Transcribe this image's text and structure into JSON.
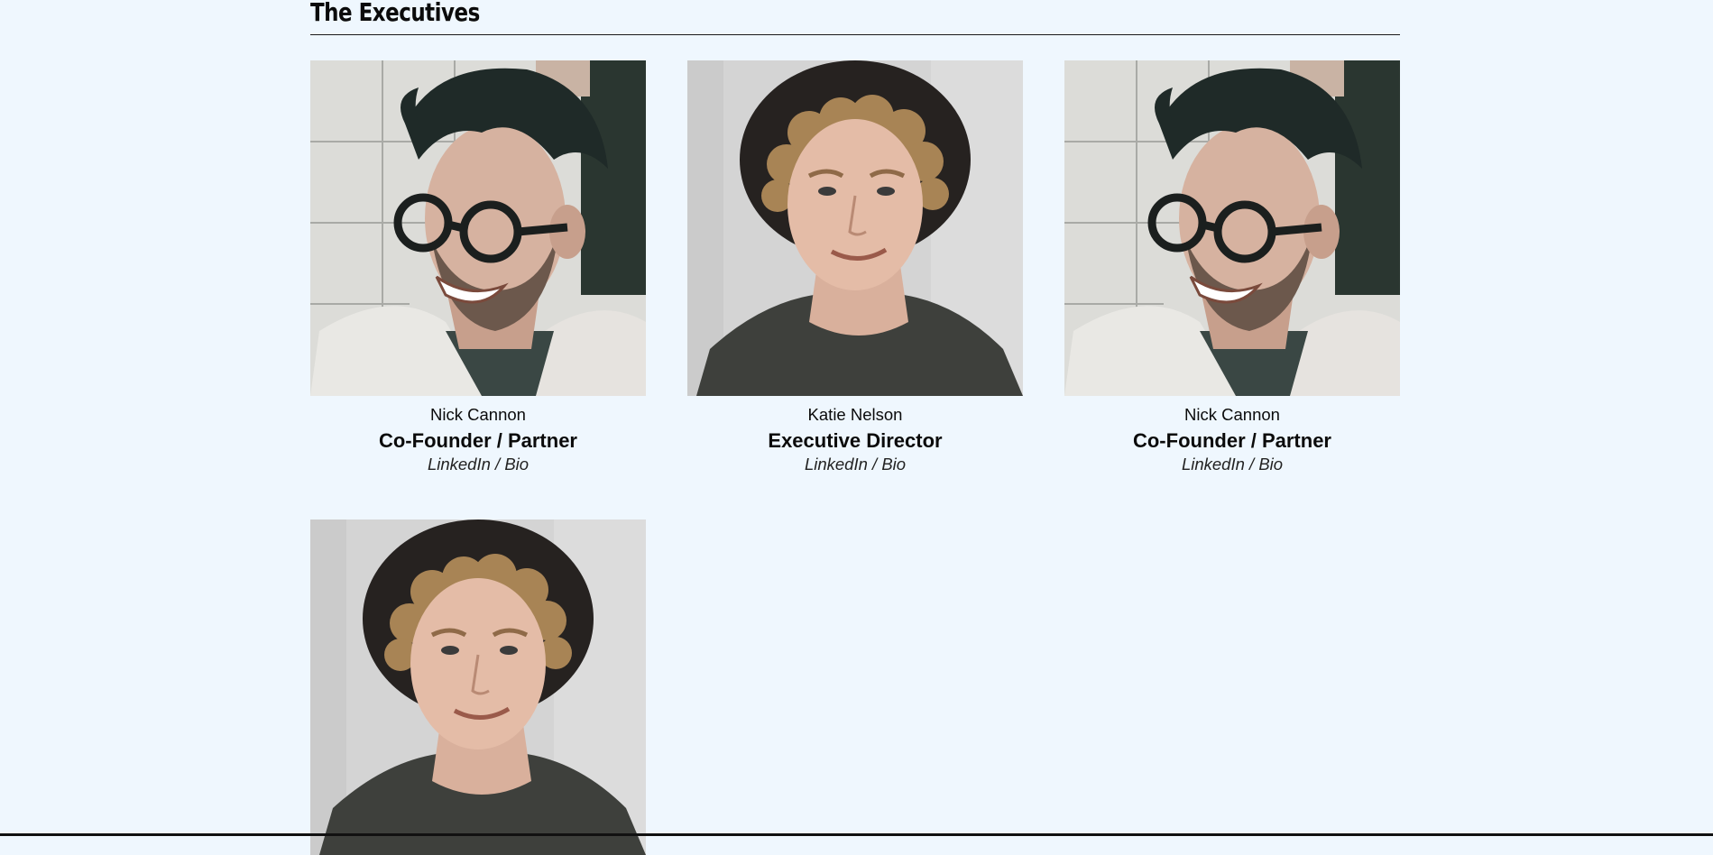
{
  "section": {
    "title": "The Executives"
  },
  "executives": [
    {
      "name": "Nick Cannon",
      "role": "Co-Founder / Partner",
      "linkedin_label": "LinkedIn",
      "separator": " / ",
      "bio_label": "Bio",
      "photo": "portrait-glasses"
    },
    {
      "name": "Katie Nelson",
      "role": "Executive Director",
      "linkedin_label": "LinkedIn",
      "separator": " / ",
      "bio_label": "Bio",
      "photo": "portrait-hat"
    },
    {
      "name": "Nick Cannon",
      "role": "Co-Founder / Partner",
      "linkedin_label": "LinkedIn",
      "separator": " / ",
      "bio_label": "Bio",
      "photo": "portrait-glasses"
    },
    {
      "photo": "portrait-hat"
    }
  ],
  "colors": {
    "page_background": "#eff7fe",
    "text": "#0b0b0b"
  }
}
